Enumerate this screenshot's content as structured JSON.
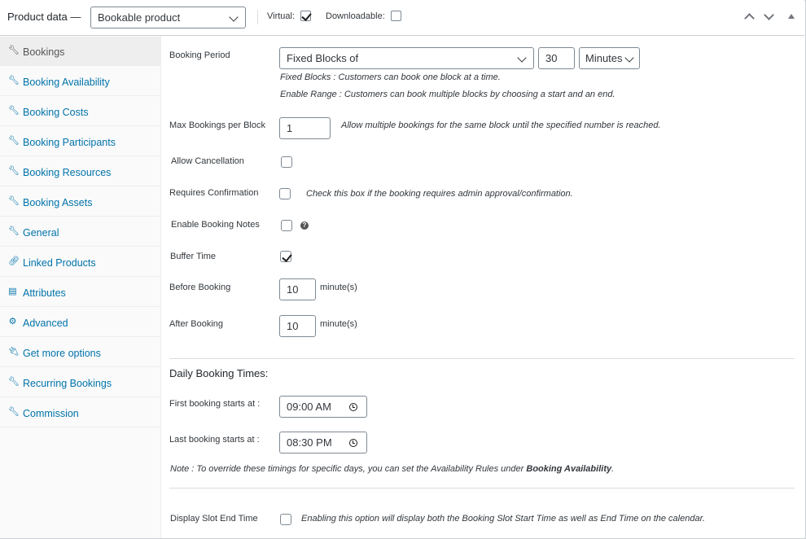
{
  "header": {
    "title": "Product data —",
    "product_type": "Bookable product",
    "virtual_label": "Virtual:",
    "virtual_checked": true,
    "downloadable_label": "Downloadable:",
    "downloadable_checked": false
  },
  "sidebar": {
    "items": [
      {
        "label": "Bookings",
        "icon": "wrench-icon",
        "active": true
      },
      {
        "label": "Booking Availability",
        "icon": "wrench-icon"
      },
      {
        "label": "Booking Costs",
        "icon": "wrench-icon"
      },
      {
        "label": "Booking Participants",
        "icon": "wrench-icon"
      },
      {
        "label": "Booking Resources",
        "icon": "wrench-icon"
      },
      {
        "label": "Booking Assets",
        "icon": "wrench-icon"
      },
      {
        "label": "General",
        "icon": "wrench-icon"
      },
      {
        "label": "Linked Products",
        "icon": "link-icon"
      },
      {
        "label": "Attributes",
        "icon": "list-icon"
      },
      {
        "label": "Advanced",
        "icon": "gear-icon"
      },
      {
        "label": "Get more options",
        "icon": "plugin-icon"
      },
      {
        "label": "Recurring Bookings",
        "icon": "wrench-icon"
      },
      {
        "label": "Commission",
        "icon": "wrench-icon"
      }
    ]
  },
  "form": {
    "booking_period": {
      "label": "Booking Period",
      "type_value": "Fixed Blocks of",
      "duration_value": "30",
      "unit_value": "Minutes",
      "desc_fixed": "Fixed Blocks : Customers can book one block at a time.",
      "desc_range": "Enable Range : Customers can book multiple blocks by choosing a start and an end."
    },
    "max_bookings": {
      "label": "Max Bookings per Block",
      "value": "1",
      "desc": "Allow multiple bookings for the same block until the specified number is reached."
    },
    "allow_cancellation": {
      "label": "Allow Cancellation",
      "checked": false
    },
    "requires_confirmation": {
      "label": "Requires Confirmation",
      "checked": false,
      "desc": "Check this box if the booking requires admin approval/confirmation."
    },
    "enable_notes": {
      "label": "Enable Booking Notes",
      "checked": false,
      "help": "?"
    },
    "buffer_time": {
      "label": "Buffer Time",
      "checked": true
    },
    "before_booking": {
      "label": "Before Booking",
      "value": "10",
      "unit": "minute(s)"
    },
    "after_booking": {
      "label": "After Booking",
      "value": "10",
      "unit": "minute(s)"
    },
    "daily_times": {
      "title": "Daily Booking Times:",
      "first_label": "First booking starts at :",
      "first_value": "09:00 AM",
      "last_label": "Last booking starts at :",
      "last_value": "08:30 PM",
      "note_prefix": "Note : To override these timings for specific days, you can set the Availability Rules under ",
      "note_bold": "Booking Availability",
      "note_suffix": "."
    },
    "display_slot_end": {
      "label": "Display Slot End Time",
      "checked": false,
      "desc": "Enabling this option will display both the Booking Slot Start Time as well as End Time on the calendar."
    }
  }
}
